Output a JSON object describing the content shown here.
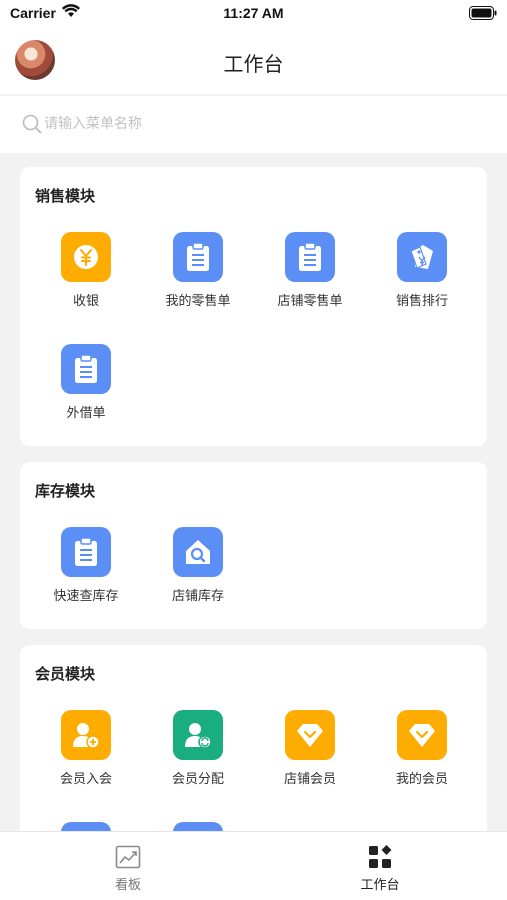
{
  "status_bar": {
    "carrier": "Carrier",
    "time": "11:27 AM"
  },
  "nav": {
    "title": "工作台"
  },
  "search": {
    "placeholder": "请输入菜单名称"
  },
  "sections": [
    {
      "title": "销售模块",
      "items": [
        {
          "label": "收银",
          "icon": "yen-icon",
          "color": "#ffac00"
        },
        {
          "label": "我的零售单",
          "icon": "clipboard-icon",
          "color": "#5b8ff6"
        },
        {
          "label": "店铺零售单",
          "icon": "clipboard-icon",
          "color": "#5b8ff6"
        },
        {
          "label": "销售排行",
          "icon": "price-tag-icon",
          "color": "#5b8ff6"
        },
        {
          "label": "外借单",
          "icon": "clipboard-icon",
          "color": "#5b8ff6"
        }
      ]
    },
    {
      "title": "库存模块",
      "items": [
        {
          "label": "快速查库存",
          "icon": "clipboard-icon",
          "color": "#5b8ff6"
        },
        {
          "label": "店铺库存",
          "icon": "house-search-icon",
          "color": "#5b8ff6"
        }
      ]
    },
    {
      "title": "会员模块",
      "items": [
        {
          "label": "会员入会",
          "icon": "user-add-icon",
          "color": "#ffac00"
        },
        {
          "label": "会员分配",
          "icon": "user-assign-icon",
          "color": "#1aad7e"
        },
        {
          "label": "店铺会员",
          "icon": "diamond-icon",
          "color": "#ffac00"
        },
        {
          "label": "我的会员",
          "icon": "diamond-icon",
          "color": "#ffac00"
        }
      ]
    }
  ],
  "tab_bar": {
    "tabs": [
      {
        "label": "看板",
        "icon": "chart-icon",
        "active": false
      },
      {
        "label": "工作台",
        "icon": "grid-icon",
        "active": true
      }
    ],
    "active_color": "#222222",
    "inactive_color": "#777777"
  }
}
